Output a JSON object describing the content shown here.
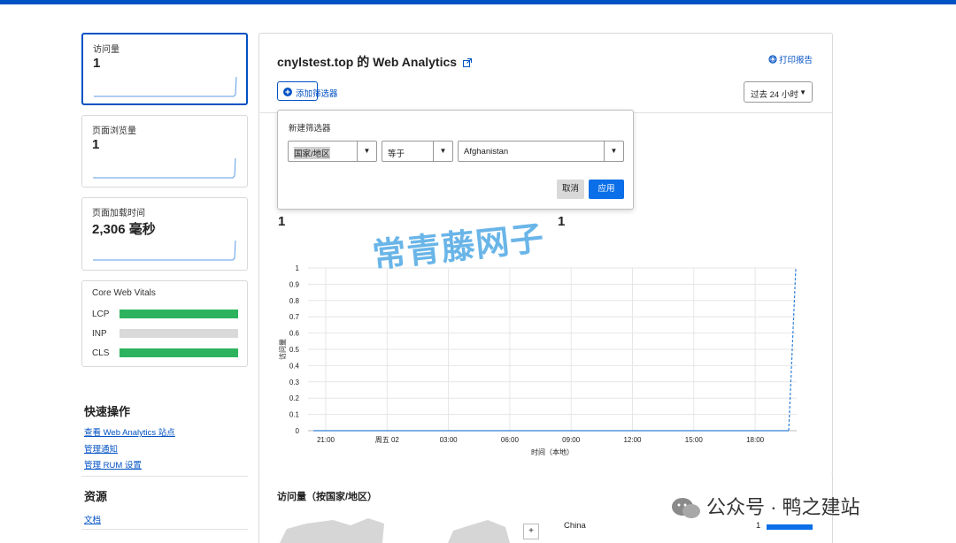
{
  "cards": {
    "visits": {
      "label": "访问量",
      "value": "1"
    },
    "pageviews": {
      "label": "页面浏览量",
      "value": "1"
    },
    "loadtime": {
      "label": "页面加载时间",
      "value": "2,306 毫秒"
    }
  },
  "cwv": {
    "title": "Core Web Vitals",
    "metrics": [
      {
        "name": "LCP",
        "color": "#2db35d"
      },
      {
        "name": "INP",
        "color": "#d9d9d9"
      },
      {
        "name": "CLS",
        "color": "#2db35d"
      }
    ]
  },
  "quick": {
    "title": "快速操作",
    "links": [
      "查看 Web Analytics 站点",
      "管理通知",
      "管理 RUM 设置"
    ]
  },
  "resources": {
    "title": "资源",
    "links": [
      "文档"
    ]
  },
  "header": {
    "title": "cnylstest.top 的 Web Analytics",
    "print": "打印报告",
    "add_filter": "添加筛选器",
    "range": "过去 24 小时"
  },
  "filter": {
    "title": "新建筛选器",
    "field": "国家/地区",
    "operator": "等于",
    "value": "Afghanistan",
    "cancel": "取消",
    "apply": "应用"
  },
  "summary": {
    "value_a": "1",
    "value_b": "1"
  },
  "chart_data": {
    "type": "line",
    "ylabel": "访问量",
    "xlabel": "时间（本地）",
    "x_ticks": [
      "21:00",
      "周五 02",
      "03:00",
      "06:00",
      "09:00",
      "12:00",
      "15:00",
      "18:00"
    ],
    "y_ticks": [
      "0",
      "0.1",
      "0.2",
      "0.3",
      "0.4",
      "0.5",
      "0.6",
      "0.7",
      "0.8",
      "0.9",
      "1"
    ],
    "ylim": [
      0,
      1
    ],
    "series": [
      {
        "values": [
          0,
          0,
          0,
          0,
          0,
          0,
          0,
          0,
          0,
          1
        ]
      }
    ],
    "grid": true,
    "color": "#2f7fd8"
  },
  "countries": {
    "title": "访问量（按国家/地区）",
    "rows": [
      {
        "name": "China",
        "value": "1"
      }
    ],
    "zoom_in": "+"
  },
  "watermark": "常青藤网子",
  "wechat": "公众号 · 鸭之建站",
  "colors": {
    "accent": "#0051c3",
    "apply": "#0a6fe8"
  }
}
